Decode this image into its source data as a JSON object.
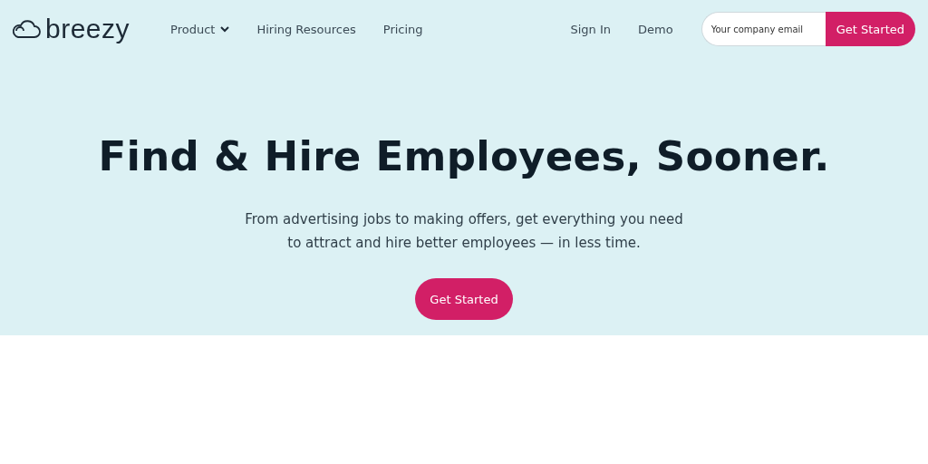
{
  "logo": {
    "text": "breezy"
  },
  "nav": [
    {
      "label": "Product",
      "dropdown": true
    },
    {
      "label": "Hiring Resources",
      "dropdown": false
    },
    {
      "label": "Pricing",
      "dropdown": false
    }
  ],
  "nav_right": [
    {
      "label": "Sign In"
    },
    {
      "label": "Demo"
    }
  ],
  "signup": {
    "placeholder": "Your company email",
    "button": "Get Started"
  },
  "hero": {
    "title": "Find & Hire Employees, Sooner.",
    "subtitle": "From advertising jobs to making offers, get everything you need to attract and hire better employees — in less time.",
    "button": "Get Started"
  }
}
